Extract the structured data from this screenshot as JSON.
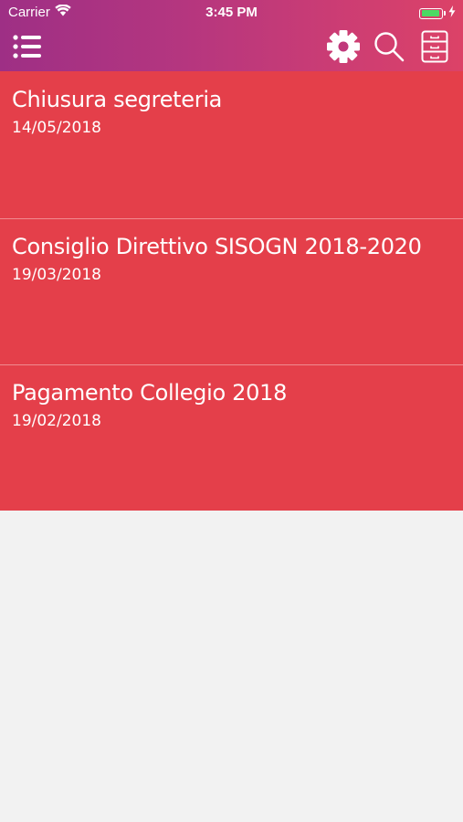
{
  "status_bar": {
    "carrier": "Carrier",
    "time": "3:45 PM",
    "battery_icon": "battery-charging-icon",
    "wifi_icon": "wifi-icon"
  },
  "toolbar": {
    "menu_icon": "list-menu-icon",
    "settings_icon": "gear-icon",
    "search_icon": "search-icon",
    "archive_icon": "file-cabinet-icon"
  },
  "colors": {
    "header_gradient_start": "#9e2f85",
    "header_gradient_end": "#dc4267",
    "item_background": "#e43f4a",
    "page_background": "#f2f2f2",
    "battery_fill": "#4cd964"
  },
  "news": [
    {
      "title": "Chiusura segreteria",
      "date": "14/05/2018"
    },
    {
      "title": "Consiglio Direttivo SISOGN 2018-2020",
      "date": "19/03/2018"
    },
    {
      "title": "Pagamento Collegio 2018",
      "date": "19/02/2018"
    }
  ]
}
